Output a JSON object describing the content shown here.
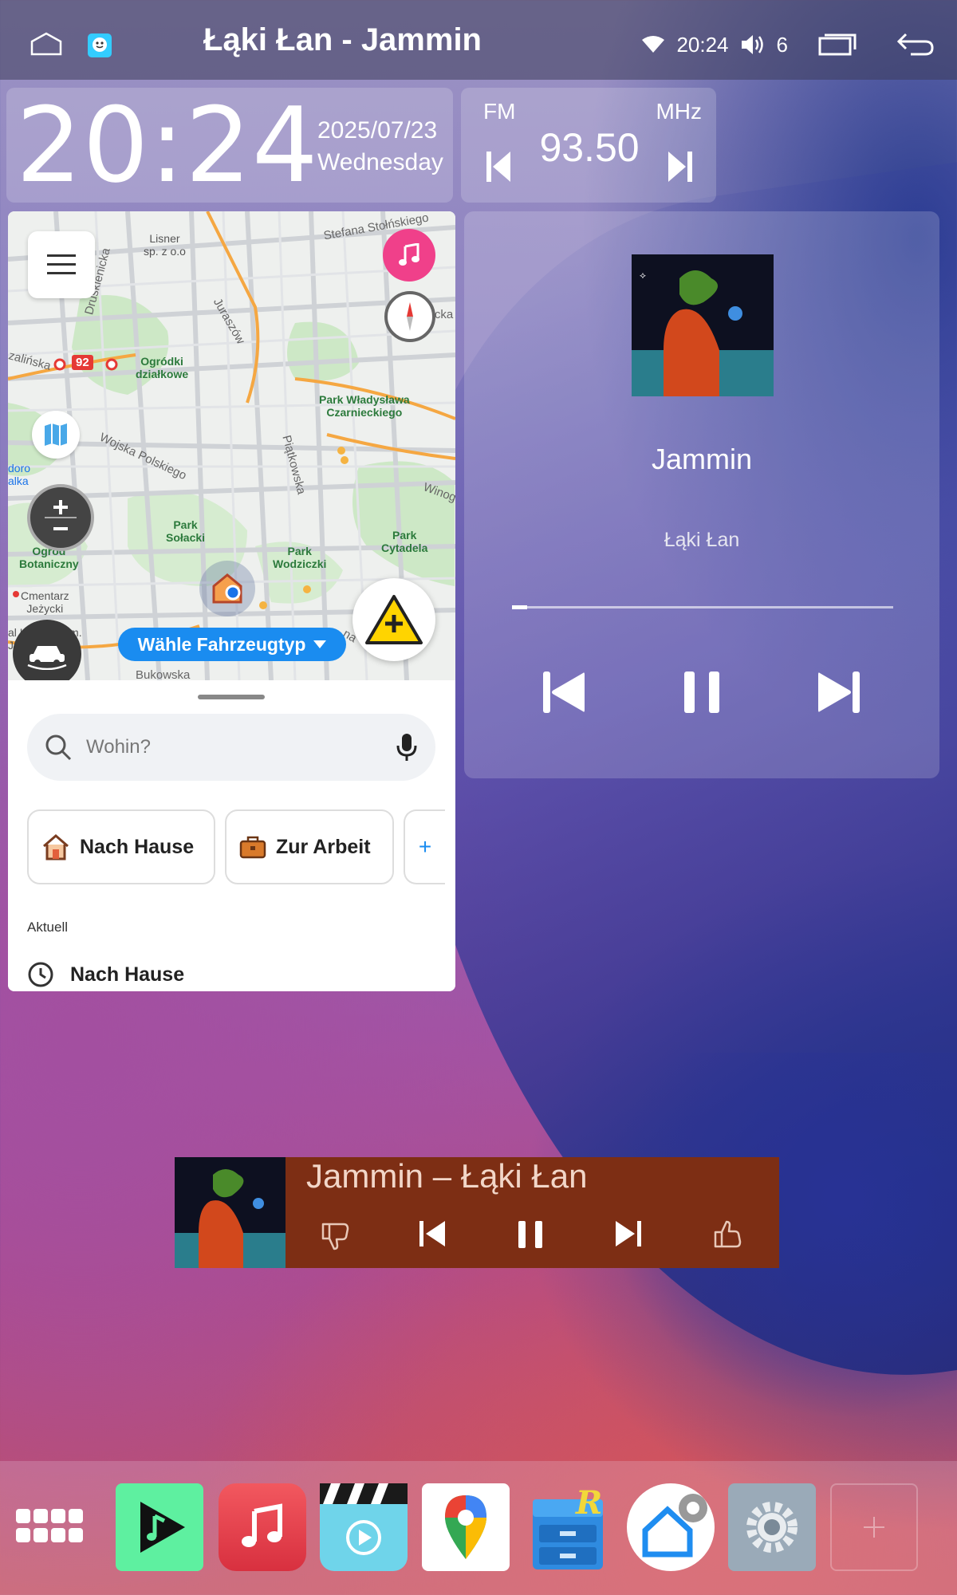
{
  "status_bar": {
    "title": "Łąki Łan - Jammin",
    "time": "20:24",
    "volume": "6"
  },
  "clock": {
    "time": "20:24",
    "date": "2025/07/23",
    "weekday": "Wednesday"
  },
  "radio": {
    "band": "FM",
    "unit": "MHz",
    "frequency": "93.50"
  },
  "waze": {
    "map_labels": {
      "lisner": "Lisner\nsp. z o.o",
      "stefana": "Stefana Stołńskiego",
      "druskienicka": "Druskienicka",
      "juraszow": "Juraszów",
      "ogrodki": "Ogródki\ndziałkowe",
      "zalinska": "zalińska",
      "park_wladyslawa": "Park Władysława\nCzarnieckiego",
      "wojska_polskiego": "Wojska Polskiego",
      "piatkowska": "Piątkowska",
      "doro_alka": "doro\nalka",
      "winog": "Winog",
      "park_solacki": "Park\nSołacki",
      "park_cytadela": "Park\nCytadela",
      "ogrod_botaniczny": "Ogród\nBotaniczny",
      "park_wodziczki": "Park\nWodziczki",
      "cmentarz": "Cmentarz\nJeżycki",
      "szpital": "al Kliniczny im.\nJonschera UM",
      "bukowska": "Bukowska",
      "na": "na",
      "sicka": "sicka"
    },
    "route_badge": "92",
    "vehicle_pill": "Wähle Fahrzeugtyp",
    "search_placeholder": "Wohin?",
    "chips": [
      {
        "label": "Nach Hause",
        "icon": "house-icon"
      },
      {
        "label": "Zur Arbeit",
        "icon": "briefcase-icon"
      },
      {
        "label": "+",
        "icon": "plus-icon"
      }
    ],
    "recent_label": "Aktuell",
    "recent_items": [
      {
        "label": "Nach Hause",
        "icon": "clock-icon"
      }
    ]
  },
  "player": {
    "song": "Jammin",
    "artist": "Łąki Łan",
    "progress": 0.04
  },
  "mini_player": {
    "title": "Jammin – Łąki Łan"
  },
  "dock": {
    "apps": [
      {
        "name": "apps-grid-icon"
      },
      {
        "name": "music-player-app",
        "color": "#5ef0a0"
      },
      {
        "name": "apple-music-app",
        "color": "#e8424f"
      },
      {
        "name": "video-player-app",
        "color": "#6fd4ea"
      },
      {
        "name": "google-maps-app",
        "color": "#ffffff"
      },
      {
        "name": "root-explorer-app",
        "color": "#2f8be0"
      },
      {
        "name": "launcher-settings-app",
        "color": "#ffffff"
      },
      {
        "name": "settings-app",
        "color": "#9aaab8"
      },
      {
        "name": "add-app-slot"
      }
    ]
  }
}
